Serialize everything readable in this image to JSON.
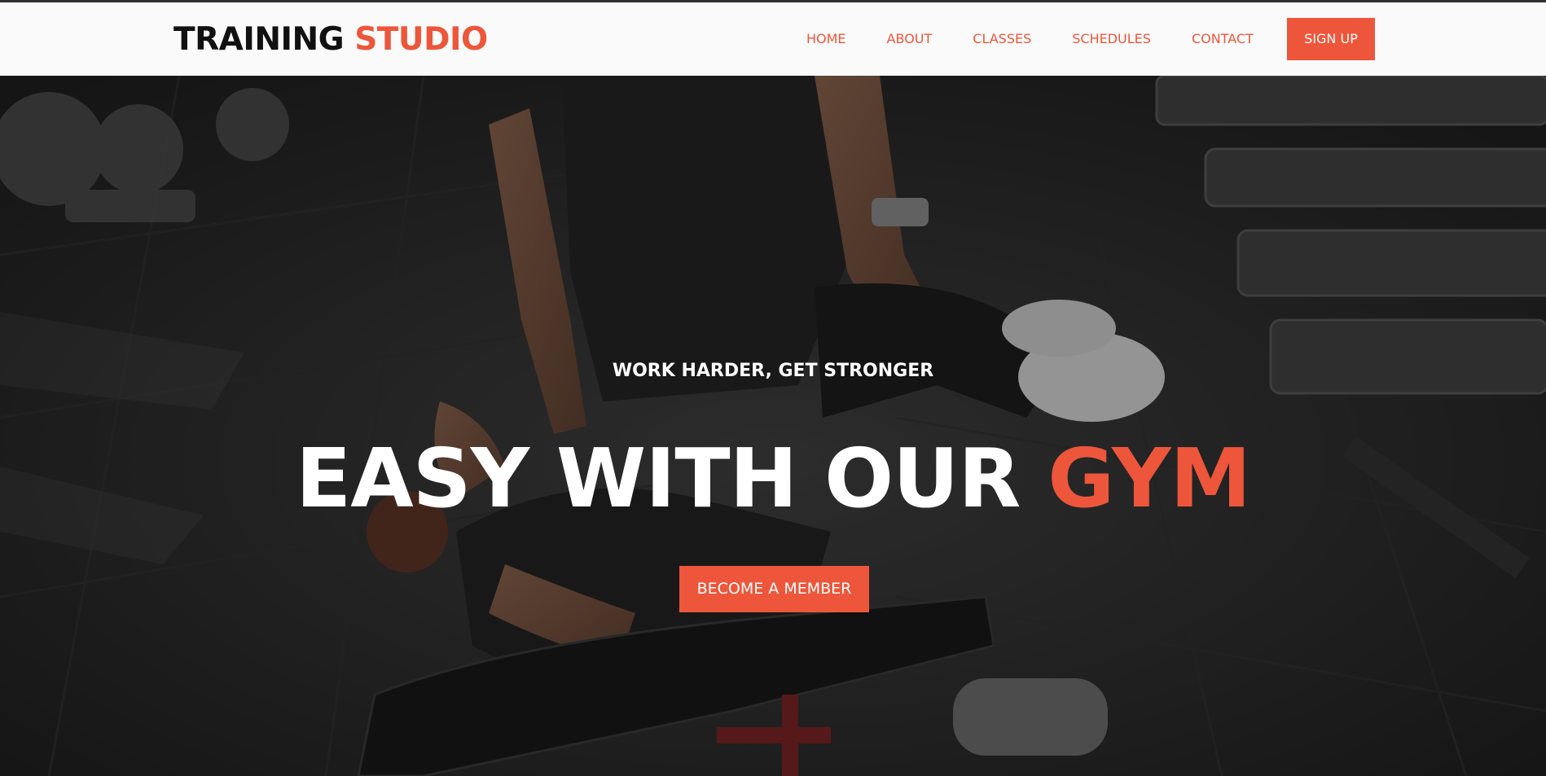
{
  "brand": {
    "name_part1": "TRAINING",
    "name_part2": "STUDIO"
  },
  "nav": {
    "items": [
      {
        "label": "HOME"
      },
      {
        "label": "ABOUT"
      },
      {
        "label": "CLASSES"
      },
      {
        "label": "SCHEDULES"
      },
      {
        "label": "CONTACT"
      }
    ],
    "signup_label": "SIGN UP"
  },
  "hero": {
    "tagline": "WORK HARDER, GET STRONGER",
    "headline_main": "EASY WITH OUR",
    "headline_accent": "GYM",
    "cta_label": "BECOME A MEMBER",
    "background_image": "gym-photo-trainer-assisting-woman-situps"
  },
  "colors": {
    "accent": "#ed563b",
    "header_bg": "#fafafa",
    "logo_dark": "#111111",
    "text_light": "#ffffff"
  }
}
